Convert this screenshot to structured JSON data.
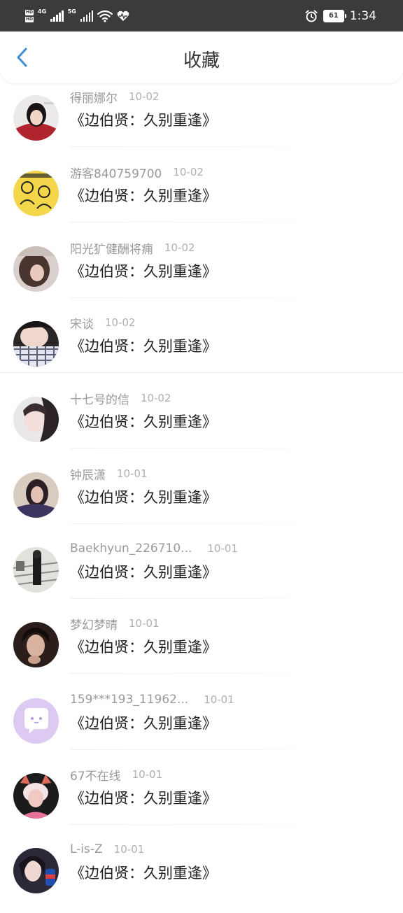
{
  "status_bar": {
    "hd_labels": [
      "HD",
      "HD"
    ],
    "network_1": "4G",
    "network_2": "5G",
    "battery": "61",
    "time": "1:34",
    "icons": [
      "signal-icon",
      "wifi-icon",
      "heart-pulse-icon",
      "alarm-icon",
      "battery-icon"
    ]
  },
  "nav": {
    "title": "收藏",
    "back_icon": "chevron-left-icon",
    "accent": "#3f8fd8"
  },
  "items": [
    {
      "user": "得丽娜尔",
      "date": "10-02",
      "title": "《边伯贤：久别重逢》",
      "avatar_color": "#7a2a2e"
    },
    {
      "user": "游客840759700",
      "date": "10-02",
      "title": "《边伯贤：久别重逢》",
      "avatar_color": "#f3d64a"
    },
    {
      "user": "阳光犷健酬将痈",
      "date": "10-02",
      "title": "《边伯贤：久别重逢》",
      "avatar_color": "#8a6e68"
    },
    {
      "user": "宋谈",
      "date": "10-02",
      "title": "《边伯贤：久别重逢》",
      "avatar_color": "#4a4a52"
    },
    {
      "user": "十七号的信",
      "date": "10-02",
      "title": "《边伯贤：久别重逢》",
      "avatar_color": "#c9c3c4"
    },
    {
      "user": "钟辰潇",
      "date": "10-01",
      "title": "《边伯贤：久别重逢》",
      "avatar_color": "#5a4a55"
    },
    {
      "user": "Baekhyun_226710...",
      "date": "10-01",
      "title": "《边伯贤：久别重逢》",
      "avatar_color": "#7d7d78"
    },
    {
      "user": "梦幻梦晴",
      "date": "10-01",
      "title": "《边伯贤：久别重逢》",
      "avatar_color": "#3a2a26"
    },
    {
      "user": "159***193_11962...",
      "date": "10-01",
      "title": "《边伯贤：久别重逢》",
      "avatar_color": "#d9c7f2"
    },
    {
      "user": "67不在线",
      "date": "10-01",
      "title": "《边伯贤：久别重逢》",
      "avatar_color": "#e8a0b6"
    },
    {
      "user": "L-is-Z",
      "date": "10-01",
      "title": "《边伯贤：久别重逢》",
      "avatar_color": "#2f2a3a"
    }
  ]
}
